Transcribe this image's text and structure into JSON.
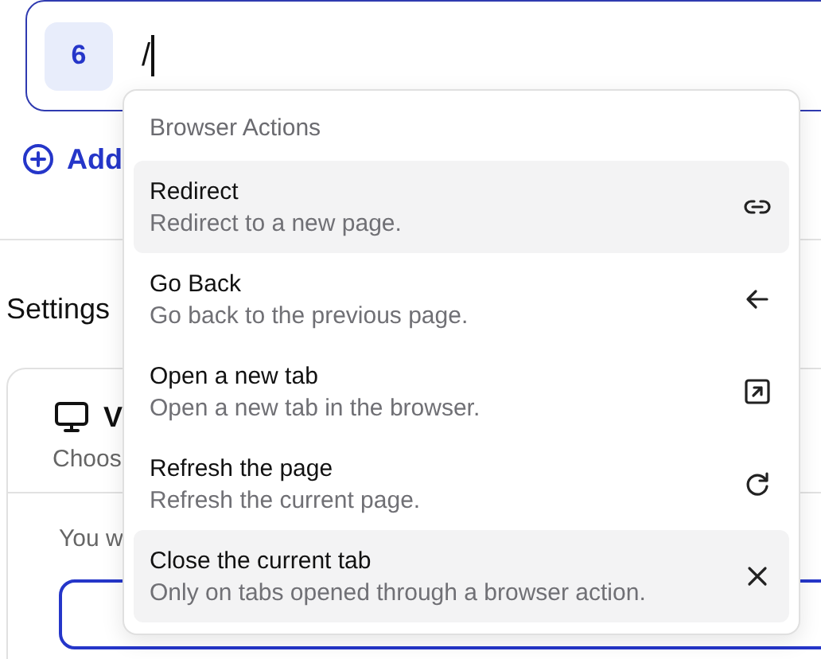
{
  "step_field": {
    "badge": "6",
    "value": "/"
  },
  "add_link": {
    "label": "Add"
  },
  "settings": {
    "title": "Settings",
    "card": {
      "title": "V",
      "subtitle": "Choos",
      "body": "You w"
    }
  },
  "menu": {
    "header": "Browser Actions",
    "items": [
      {
        "title": "Redirect",
        "description": "Redirect to a new page.",
        "kind": "link",
        "highlighted": true
      },
      {
        "title": "Go Back",
        "description": "Go back to the previous page.",
        "kind": "back",
        "highlighted": false
      },
      {
        "title": "Open a new tab",
        "description": "Open a new tab in the browser.",
        "kind": "external",
        "highlighted": false
      },
      {
        "title": "Refresh the page",
        "description": "Refresh the current page.",
        "kind": "refresh",
        "highlighted": false
      },
      {
        "title": "Close the current tab",
        "description": "Only on tabs opened through a browser action.",
        "kind": "close",
        "highlighted": true
      }
    ]
  }
}
